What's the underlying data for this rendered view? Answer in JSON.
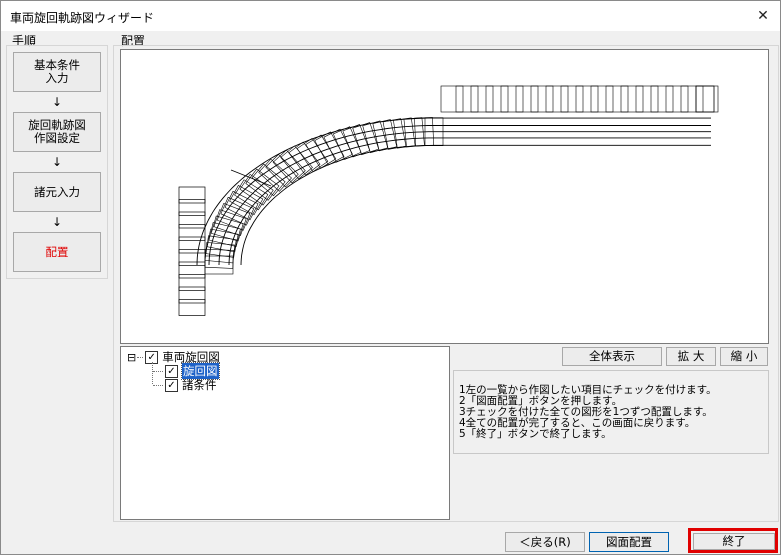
{
  "window": {
    "title": "車両旋回軌跡図ウィザード",
    "close_glyph": "✕"
  },
  "steps": {
    "label": "手順",
    "items": [
      {
        "label": "基本条件\n入力"
      },
      {
        "label": "旋回軌跡図\n作図設定"
      },
      {
        "label": "諸元入力"
      },
      {
        "label": "配置"
      }
    ],
    "arrow": "↓"
  },
  "layout": {
    "label": "配置"
  },
  "tree": {
    "root": {
      "label": "車両旋回図",
      "checked": true
    },
    "children": [
      {
        "label": "旋回図",
        "checked": true,
        "selected": true
      },
      {
        "label": "諸条件",
        "checked": true
      }
    ],
    "expander": "⊟"
  },
  "view_buttons": {
    "fit": "全体表示",
    "zoom_in": "拡 大",
    "zoom_out": "縮 小"
  },
  "instructions": [
    "1左の一覧から作図したい項目にチェックを付けます。",
    "2「図面配置」ボタンを押します。",
    "3チェックを付けた全ての図形を1つずつ配置します。",
    "4全ての配置が完了すると、この画面に戻ります。",
    "5「終了」ボタンで終了します。"
  ],
  "footer": {
    "back": "＜戻る(R)",
    "place": "図面配置",
    "finish": "終了"
  },
  "colors": {
    "active_step": "#e00000",
    "highlight_border": "#e00000",
    "selection": "#1e62c8"
  }
}
